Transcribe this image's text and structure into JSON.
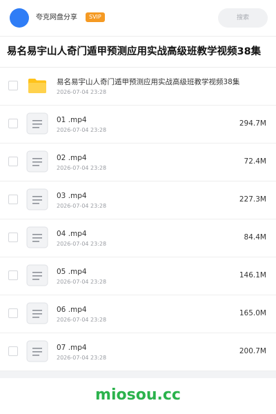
{
  "header": {
    "brand": "夸克网盘分享",
    "badge": "SVIP",
    "search_placeholder": "搜索"
  },
  "title": "易名易宇山人奇门遁甲预测应用实战高级班教学视频38集",
  "folder": {
    "name": "易名易宇山人奇门遁甲预测应用实战高级班教学视频38集",
    "date": "2026-07-04 23:28",
    "icon": "folder-icon"
  },
  "files": [
    {
      "name": "01 .mp4",
      "date": "2026-07-04 23:28",
      "size": "294.7M",
      "icon": "document-icon"
    },
    {
      "name": "02 .mp4",
      "date": "2026-07-04 23:28",
      "size": "72.4M",
      "icon": "document-icon"
    },
    {
      "name": "03 .mp4",
      "date": "2026-07-04 23:28",
      "size": "227.3M",
      "icon": "document-icon"
    },
    {
      "name": "04 .mp4",
      "date": "2026-07-04 23:28",
      "size": "84.4M",
      "icon": "document-icon"
    },
    {
      "name": "05 .mp4",
      "date": "2026-07-04 23:28",
      "size": "146.1M",
      "icon": "document-icon"
    },
    {
      "name": "06 .mp4",
      "date": "2026-07-04 23:28",
      "size": "165.0M",
      "icon": "document-icon"
    },
    {
      "name": "07 .mp4",
      "date": "2026-07-04 23:28",
      "size": "200.7M",
      "icon": "document-icon"
    }
  ],
  "footer": {
    "link": "miosou.cc"
  },
  "colors": {
    "accent": "#2f7df6",
    "badge": "#f59a23",
    "folder": "#ffc21a",
    "footer_link": "#2bb24c"
  }
}
